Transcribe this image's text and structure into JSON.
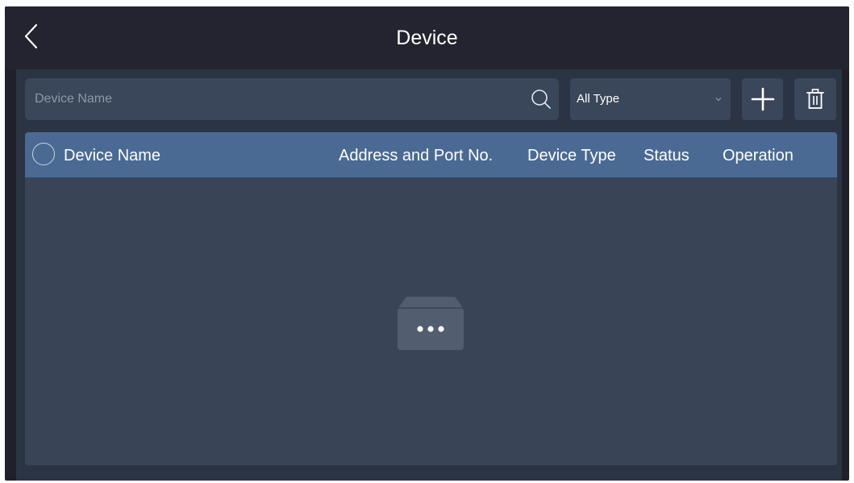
{
  "header": {
    "title": "Device",
    "back_icon": "chevron-left-icon"
  },
  "toolbar": {
    "search_placeholder": "Device Name",
    "search_value": "",
    "search_icon": "search-icon",
    "type_filter": "All Type",
    "add_icon": "plus-icon",
    "delete_icon": "trash-icon"
  },
  "table": {
    "columns": [
      "Device Name",
      "Address and Port No.",
      "Device Type",
      "Status",
      "Operation"
    ],
    "rows": [],
    "empty_icon": "empty-box-icon"
  },
  "colors": {
    "background": "#1f2029",
    "panel": "#2b3444",
    "control": "#3a4659",
    "table_header": "#4a6a93",
    "table_body": "#394457"
  }
}
